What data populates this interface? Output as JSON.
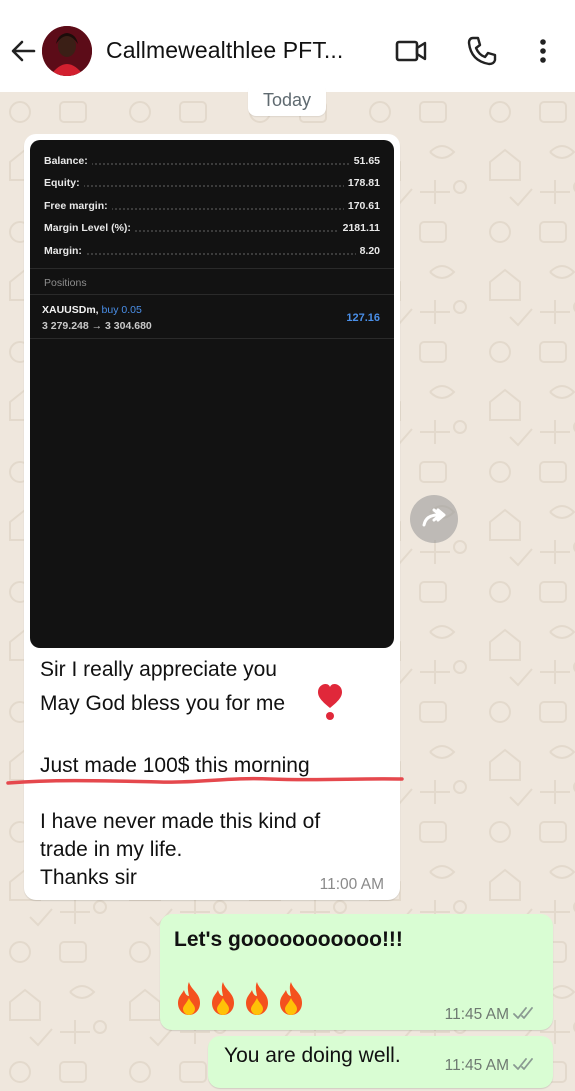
{
  "header": {
    "contact_name": "Callmewealthlee PFT...",
    "back_icon": "arrow-back-icon",
    "video_icon": "video-call-icon",
    "call_icon": "phone-icon",
    "menu_icon": "more-vert-icon"
  },
  "day_chip": "Today",
  "incoming": {
    "account": [
      {
        "label": "Balance:",
        "value": "51.65"
      },
      {
        "label": "Equity:",
        "value": "178.81"
      },
      {
        "label": "Free margin:",
        "value": "170.61"
      },
      {
        "label": "Margin Level (%):",
        "value": "2181.11"
      },
      {
        "label": "Margin:",
        "value": "8.20"
      }
    ],
    "positions_heading": "Positions",
    "position": {
      "symbol": "XAUUSDm,",
      "side": "buy 0.05",
      "prices": "3 279.248 → 3 304.680",
      "profit": "127.16"
    },
    "lines": [
      "Sir I really appreciate you",
      "May God bless you for me",
      "Just made 100$ this morning",
      "I have never made this kind of",
      "trade in my life.",
      "Thanks sir"
    ],
    "emoji": "heart-exclamation-icon",
    "time": "11:00 AM"
  },
  "outgoing": [
    {
      "text": "Let's gooooooooooo!!!",
      "emoji": "fire-icon x4",
      "time": "11:45 AM"
    },
    {
      "text": "You are doing well.",
      "time": "11:45 AM"
    }
  ],
  "colors": {
    "background": "#efe7dd",
    "outgoing_bubble": "#d9fdd3",
    "incoming_bubble": "#ffffff",
    "underline": "#e5484d",
    "profit_blue": "#4a8fe8",
    "read_ticks": "#8a9a92"
  }
}
